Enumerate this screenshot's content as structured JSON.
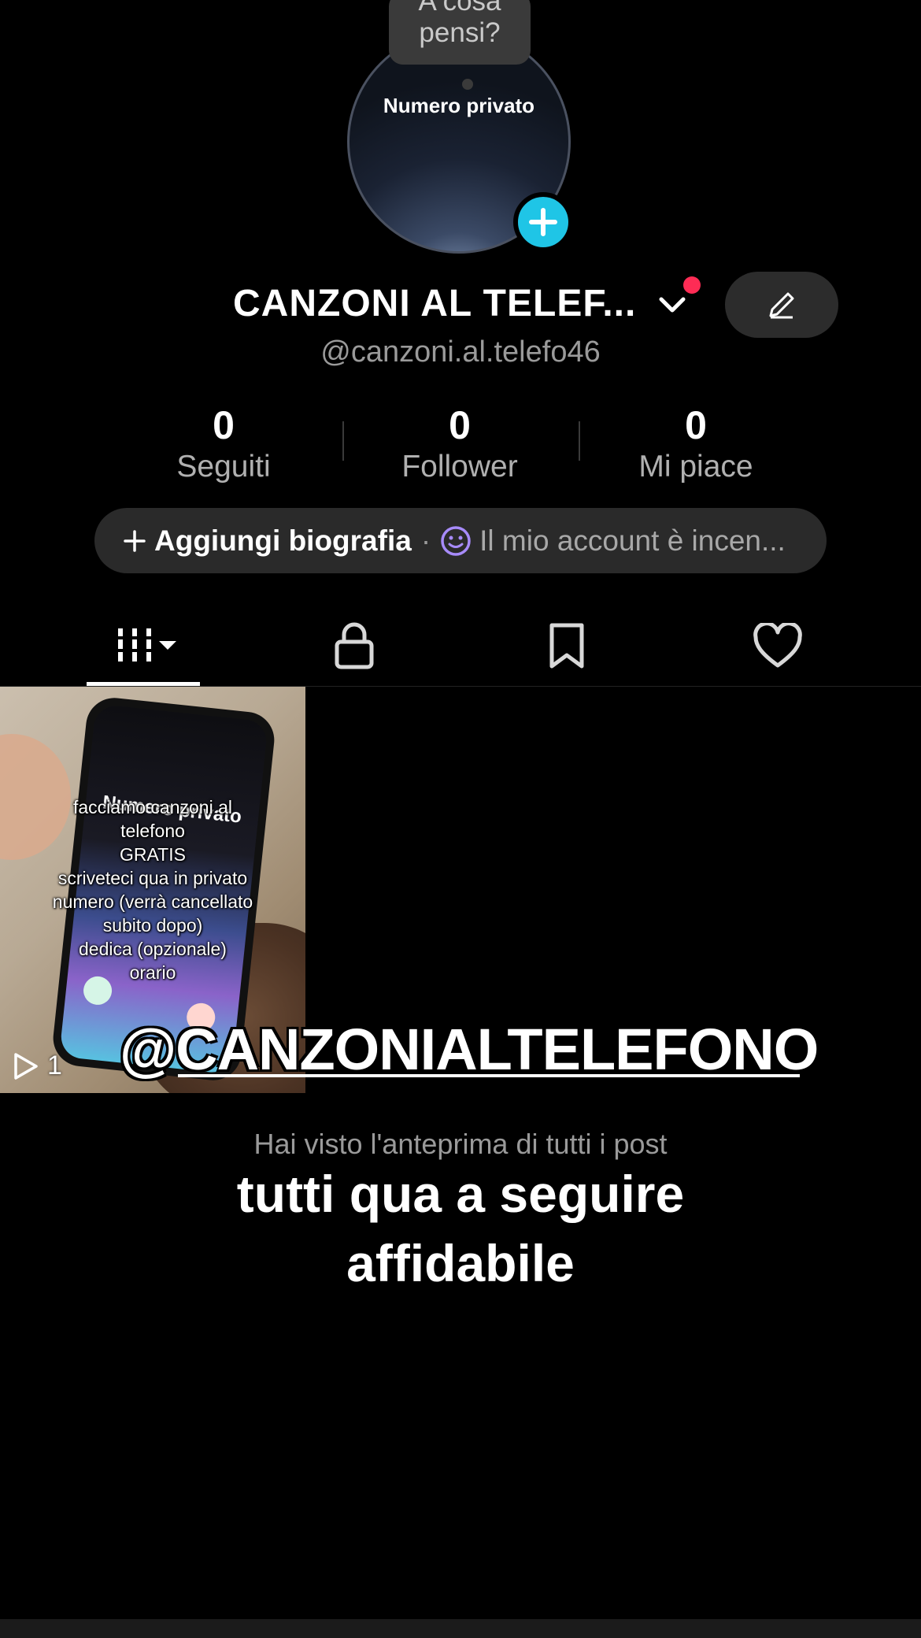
{
  "avatar": {
    "image_text": "Numero privato",
    "thought_bubble": [
      "A cosa",
      "pensi?"
    ]
  },
  "profile": {
    "name": "CANZONI AL TELEF...",
    "handle": "@canzoni.al.telefo46"
  },
  "stats": [
    {
      "value": "0",
      "label": "Seguiti"
    },
    {
      "value": "0",
      "label": "Follower"
    },
    {
      "value": "0",
      "label": "Mi piace"
    }
  ],
  "bio": {
    "add_label": "Aggiungi biografia",
    "separator": "·",
    "status_text": "Il mio account è incen..."
  },
  "tabs": [
    {
      "name": "videos",
      "icon": "grid-icon",
      "active": true
    },
    {
      "name": "private",
      "icon": "lock-icon"
    },
    {
      "name": "saved",
      "icon": "bookmark-icon"
    },
    {
      "name": "liked",
      "icon": "heart-icon"
    }
  ],
  "video": {
    "caption_lines": [
      "facciamo canzoni al",
      "telefono",
      "GRATIS",
      "scriveteci qua in privato",
      "numero (verrà cancellato",
      "subito dopo)",
      "dedica (opzionale)",
      "orario"
    ],
    "screen_text": "Numero privato",
    "play_count": "1"
  },
  "overlay": {
    "handle": "@CANZONIALTELEFONO",
    "preview_text": "Hai visto l'anteprima di tutti i post",
    "big_line1": "tutti qua a seguire",
    "big_line2": "affidabile"
  },
  "colors": {
    "accent_cyan": "#1fc5e6",
    "notification_red": "#fe2c55",
    "background": "#000000"
  }
}
